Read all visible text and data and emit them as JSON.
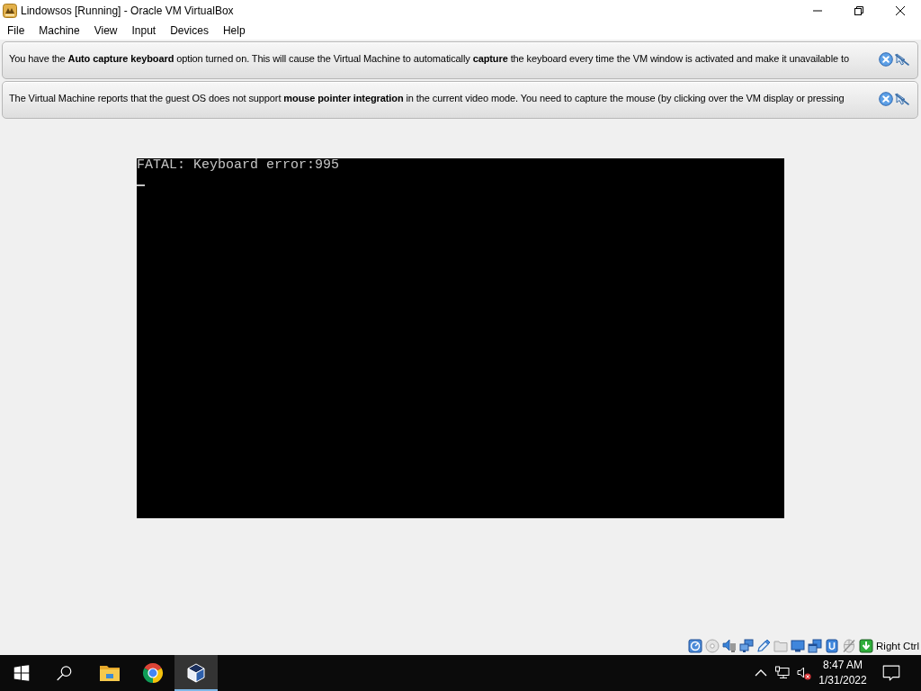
{
  "window": {
    "title": "Lindowsos [Running] - Oracle VM VirtualBox"
  },
  "menu": [
    "File",
    "Machine",
    "View",
    "Input",
    "Devices",
    "Help"
  ],
  "notices": [
    {
      "text": "You have the **Auto capture keyboard** option turned on. This will cause the Virtual Machine to automatically **capture** the keyboard every time the VM window is activated and make it unavailable to"
    },
    {
      "text": "The Virtual Machine reports that the guest OS does not support **mouse pointer integration** in the current video mode. You need to capture the mouse (by clicking over the VM display or pressing"
    }
  ],
  "vm_display": {
    "lines": [
      "FATAL: Keyboard error:995"
    ]
  },
  "status_bar": {
    "host_key": "Right Ctrl"
  },
  "taskbar": {
    "apps": [
      {
        "kind": "folder",
        "selected": false
      },
      {
        "kind": "browser",
        "selected": false
      },
      {
        "kind": "virtualbox",
        "selected": true
      }
    ],
    "clock": {
      "time": "8:47 AM",
      "date": "1/31/2022"
    }
  }
}
